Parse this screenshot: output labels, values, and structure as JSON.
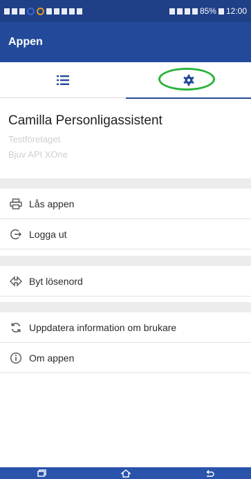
{
  "status_bar": {
    "battery": "85%",
    "time": "12:00",
    "left_icons": [
      "notification-icon",
      "notification-icon",
      "download-icon",
      "circle-app-icon",
      "circle-app-icon",
      "app-icon",
      "app-icon",
      "download-icon",
      "n-icon",
      "image-icon"
    ],
    "right_icons": [
      "bluetooth-icon",
      "vibrate-icon",
      "wifi-icon",
      "signal-icon",
      "battery-icon"
    ]
  },
  "app_bar": {
    "title": "Appen"
  },
  "tabs": [
    {
      "id": "list",
      "icon": "list-icon",
      "active": false
    },
    {
      "id": "settings",
      "icon": "gear-icon",
      "active": true
    }
  ],
  "user": {
    "name": "Camilla Personligassistent",
    "company": "Testföretaget",
    "api": "Bjuv API XOne"
  },
  "menu_groups": [
    [
      {
        "label": "Lås appen",
        "icon": "printer-icon"
      },
      {
        "label": "Logga ut",
        "icon": "logout-icon"
      }
    ],
    [
      {
        "label": "Byt lösenord",
        "icon": "swap-icon"
      }
    ],
    [
      {
        "label": "Uppdatera information om brukare",
        "icon": "refresh-icon"
      },
      {
        "label": "Om appen",
        "icon": "info-icon"
      }
    ]
  ],
  "nav_bar": {
    "icons": [
      "recent-apps-icon",
      "home-icon",
      "back-icon"
    ]
  },
  "colors": {
    "primary": "#234a9a",
    "status_bar": "#1f3f86",
    "highlight": "#29b33a",
    "divider": "#ececec",
    "secondary_text": "#cfcfcf"
  }
}
